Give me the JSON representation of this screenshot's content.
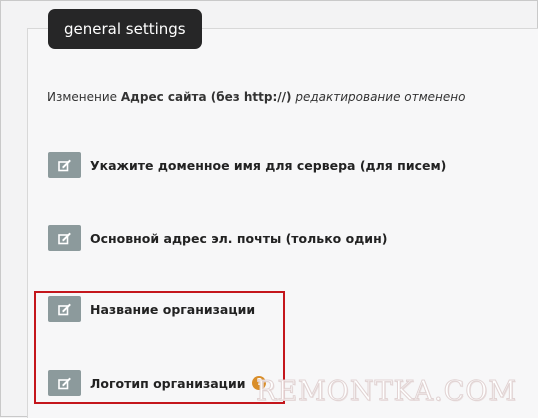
{
  "tab": {
    "label": "general settings"
  },
  "notice": {
    "prefix": "Изменение ",
    "field": "Адрес сайта (без http://)",
    "suffix": " редактирование отменено"
  },
  "settings": [
    {
      "label": "Укажите доменное имя для сервера (для писем)",
      "icon": "edit-icon"
    },
    {
      "label": "Основной адрес эл. почты (только один)",
      "icon": "edit-icon"
    },
    {
      "label": "Название организации",
      "icon": "edit-icon"
    },
    {
      "label": "Логотип организации",
      "icon": "edit-icon",
      "help": "?"
    }
  ],
  "watermark": "REMONTKA.COM",
  "colors": {
    "tab_bg": "#262627",
    "edit_button": "#8c9a9c",
    "highlight": "#c4161c",
    "help_icon": "#d98e2a"
  }
}
